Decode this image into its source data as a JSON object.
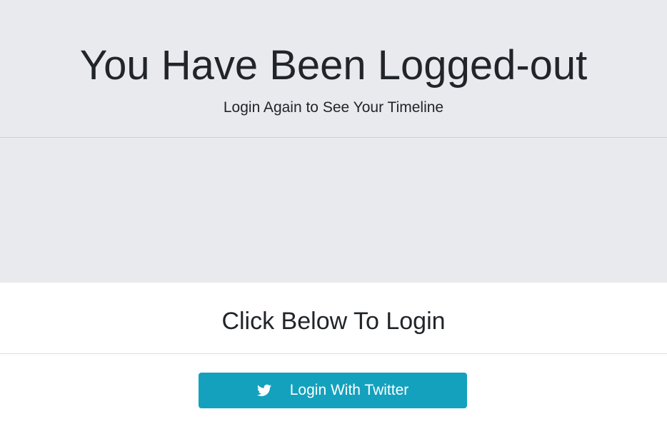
{
  "hero": {
    "title": "You Have Been Logged-out",
    "subtitle": "Login Again to See Your Timeline"
  },
  "login_card": {
    "title": "Click Below To Login",
    "button_label": "Login With Twitter",
    "button_icon": "twitter-icon"
  },
  "colors": {
    "hero_background": "#e9eaee",
    "button_background": "#14a1bd",
    "text": "#212529"
  }
}
